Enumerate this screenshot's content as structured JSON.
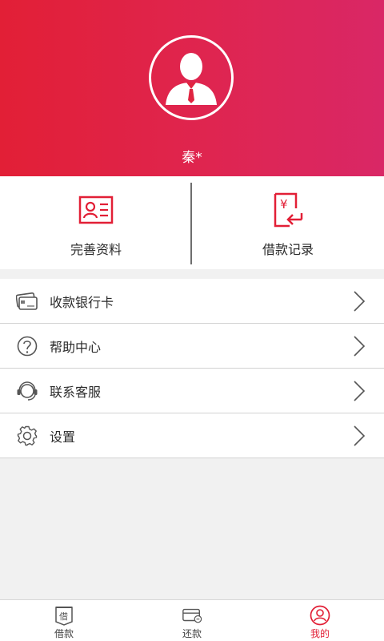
{
  "profile": {
    "username": "秦*"
  },
  "actions": [
    {
      "label": "完善资料",
      "icon": "id-card-icon"
    },
    {
      "label": "借款记录",
      "icon": "loan-record-icon"
    }
  ],
  "menu": [
    {
      "label": "收款银行卡",
      "icon": "bank-card-icon"
    },
    {
      "label": "帮助中心",
      "icon": "help-icon"
    },
    {
      "label": "联系客服",
      "icon": "headset-icon"
    },
    {
      "label": "设置",
      "icon": "settings-icon"
    }
  ],
  "tabs": [
    {
      "label": "借款",
      "icon": "borrow-icon",
      "active": false
    },
    {
      "label": "还款",
      "icon": "repay-icon",
      "active": false
    },
    {
      "label": "我的",
      "icon": "profile-icon",
      "active": true
    }
  ],
  "colors": {
    "brand": "#e21f36",
    "header_gradient_end": "#d92766",
    "text": "#2b2b2b",
    "background": "#f1f1f1"
  }
}
